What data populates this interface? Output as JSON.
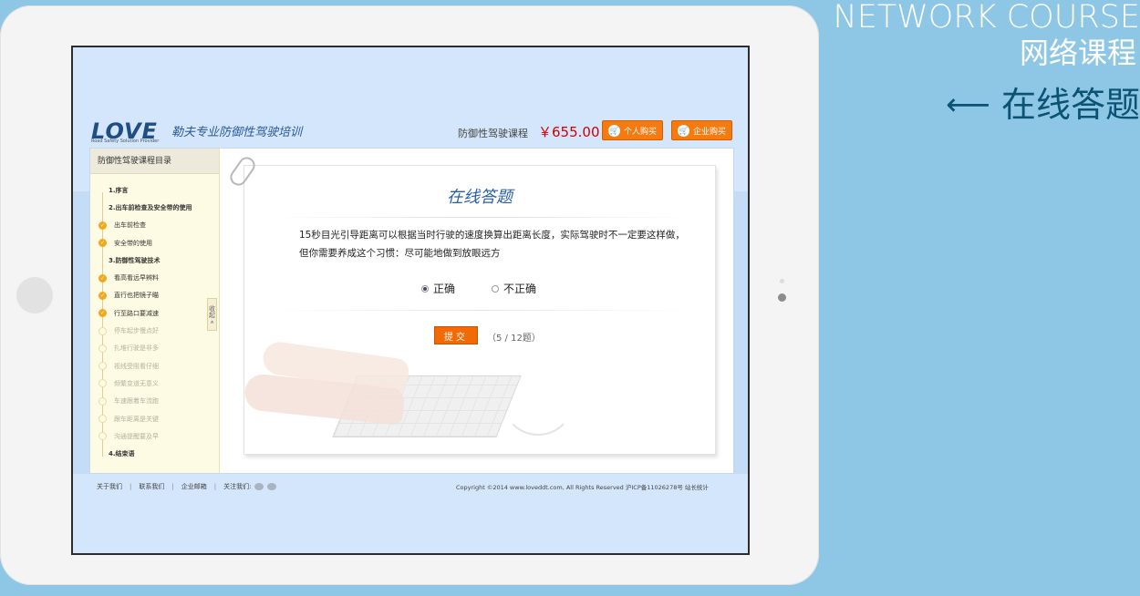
{
  "caption": {
    "en": "NETWORK COURSE",
    "cn": "网络课程",
    "page": "在线答题"
  },
  "site": {
    "logo": "LOVE",
    "logo_sub": "Road Safety Solution Provider",
    "slogan": "勒夫专业防御性驾驶培训",
    "course_label": "防御性驾驶课程",
    "price": "￥655.00",
    "buy_personal": "个人购买",
    "buy_company": "企业购买"
  },
  "sidebar": {
    "title": "防御性驾驶课程目录",
    "collapse": "收起 «",
    "items": [
      {
        "label": "1.序言",
        "status": "section"
      },
      {
        "label": "2.出车前检查及安全带的使用",
        "status": "section"
      },
      {
        "label": "出车前检查",
        "status": "done"
      },
      {
        "label": "安全带的使用",
        "status": "done"
      },
      {
        "label": "3.防御性驾驶技术",
        "status": "section"
      },
      {
        "label": "看高看远早辨料",
        "status": "done"
      },
      {
        "label": "直行也把镜子瞄",
        "status": "done"
      },
      {
        "label": "行至路口要减速",
        "status": "done"
      },
      {
        "label": "停车起步慢点好",
        "status": "todo"
      },
      {
        "label": "扎堆行驶是非多",
        "status": "todo"
      },
      {
        "label": "视线受阻看仔细",
        "status": "todo"
      },
      {
        "label": "频繁变道无意义",
        "status": "todo"
      },
      {
        "label": "车速跟着车流跑",
        "status": "todo"
      },
      {
        "label": "跟车距离是关键",
        "status": "todo"
      },
      {
        "label": "沟通提醒要及早",
        "status": "todo"
      },
      {
        "label": "4.结束语",
        "status": "section"
      }
    ]
  },
  "quiz": {
    "title": "在线答题",
    "question_line1": "15秒目光引导距离可以根据当时行驶的速度换算出距离长度，实际驾驶时不一定要这样做，",
    "question_line2": "但你需要养成这个习惯：尽可能地做到放眼远方",
    "options": [
      {
        "label": "正确",
        "selected": true
      },
      {
        "label": "不正确",
        "selected": false
      }
    ],
    "submit": "提交",
    "progress": "（5 / 12题）"
  },
  "footer": {
    "links": [
      "关于我们",
      "联系我们",
      "企业邮箱",
      "关注我们:"
    ],
    "copyright": "Copyright ©2014 www.loveddt.com, All Rights Reserved 沪ICP备11026278号   站长统计"
  },
  "colors": {
    "background": "#8ec7e6",
    "accent_orange": "#f26a06",
    "title_blue": "#2a5fa8",
    "caption_dark": "#0b5273"
  }
}
